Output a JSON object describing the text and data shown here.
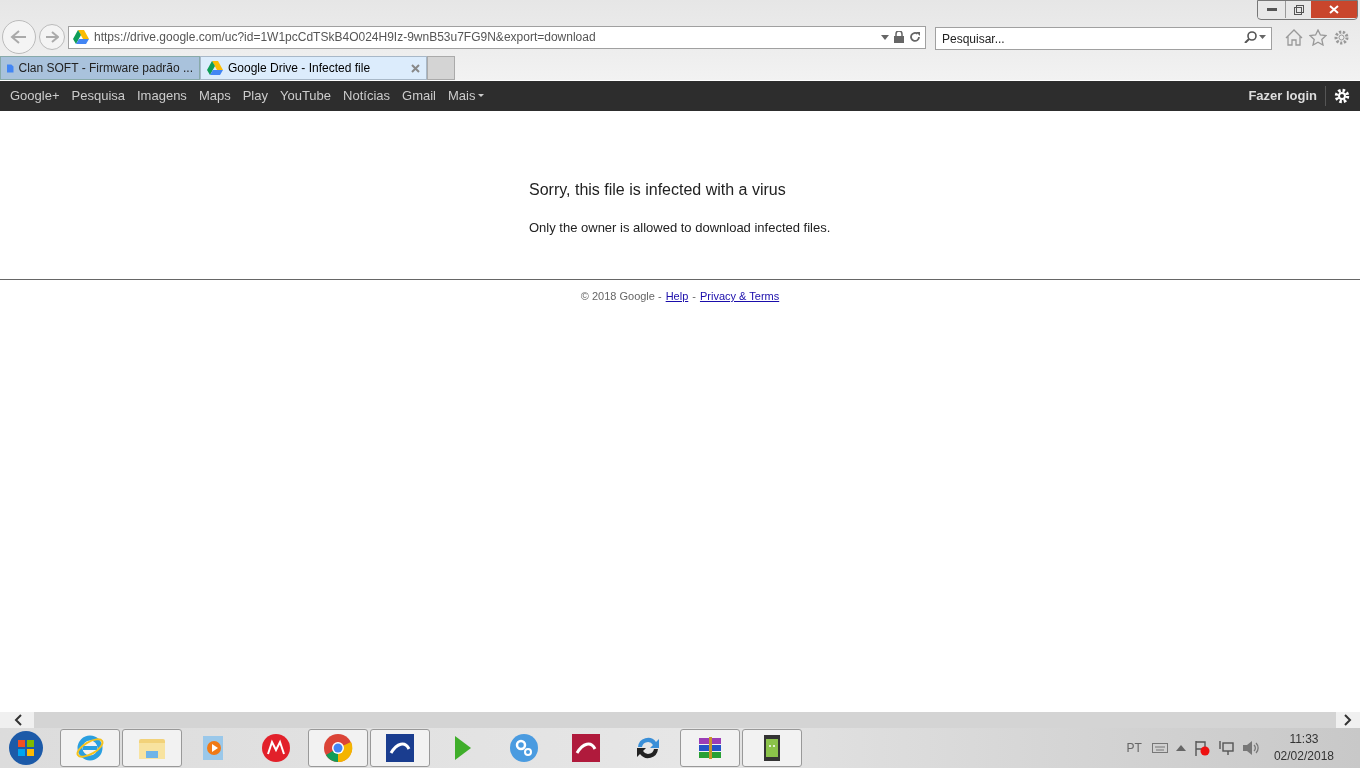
{
  "browser": {
    "url": "https://drive.google.com/uc?id=1W1pcCdTSkB4O024H9Iz-9wnB53u7FG9N&export=download",
    "search": {
      "placeholder": "Pesquisar..."
    }
  },
  "tabs": [
    {
      "label": "Clan SOFT - Firmware padrão ...",
      "selected": false,
      "kind": "doc"
    },
    {
      "label": "Google Drive - Infected file",
      "selected": true,
      "kind": "drive"
    }
  ],
  "navbar": {
    "items": [
      "Google+",
      "Pesquisa",
      "Imagens",
      "Maps",
      "Play",
      "YouTube",
      "Notícias",
      "Gmail",
      "Mais"
    ],
    "login": "Fazer login"
  },
  "message": {
    "title": "Sorry, this file is infected with a virus",
    "body": "Only the owner is allowed to download infected files."
  },
  "footer": {
    "copyright": "© 2018 Google -",
    "separator": "-",
    "links": [
      "Help",
      "Privacy & Terms"
    ]
  },
  "taskbar": {
    "apps": [
      {
        "kind": "ie",
        "pinned": true
      },
      {
        "kind": "folder",
        "pinned": true
      },
      {
        "kind": "media",
        "pinned": false
      },
      {
        "kind": "moto",
        "pinned": false
      },
      {
        "kind": "chrome",
        "pinned": true
      },
      {
        "kind": "blue",
        "pinned": true
      },
      {
        "kind": "play",
        "pinned": false
      },
      {
        "kind": "gears",
        "pinned": false
      },
      {
        "kind": "red",
        "pinned": false
      },
      {
        "kind": "sync",
        "pinned": false
      },
      {
        "kind": "rar",
        "pinned": true
      },
      {
        "kind": "android",
        "pinned": true
      }
    ],
    "language": "PT",
    "time": "11:33",
    "date": "02/02/2018"
  }
}
